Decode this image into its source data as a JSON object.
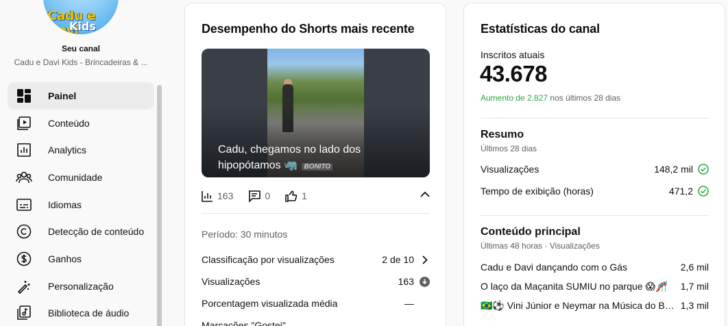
{
  "sidebar": {
    "channel_label": "Seu canal",
    "channel_name": "Cadu e Davi Kids - Brincadeiras & ...",
    "logo_text_line1": "Cadu e Davi",
    "logo_text_line2": "Kids",
    "items": [
      {
        "label": "Painel",
        "icon": "dashboard-icon",
        "active": true
      },
      {
        "label": "Conteúdo",
        "icon": "content-icon"
      },
      {
        "label": "Analytics",
        "icon": "analytics-icon"
      },
      {
        "label": "Comunidade",
        "icon": "community-icon"
      },
      {
        "label": "Idiomas",
        "icon": "subtitles-icon"
      },
      {
        "label": "Detecção de conteúdo",
        "icon": "copyright-icon"
      },
      {
        "label": "Ganhos",
        "icon": "earn-icon"
      },
      {
        "label": "Personalização",
        "icon": "customization-icon"
      },
      {
        "label": "Biblioteca de áudio",
        "icon": "audio-library-icon"
      }
    ]
  },
  "shorts_card": {
    "title": "Desempenho do Shorts mais recente",
    "thumbnail_caption": "Cadu, chegamos no lado dos hipopótamos 🦏",
    "thumbnail_tag": "BONITO",
    "metrics": {
      "views": "163",
      "comments": "0",
      "likes": "1"
    },
    "period": "Período: 30 minutos",
    "rows": [
      {
        "label": "Classificação por visualizações",
        "value": "2 de 10",
        "icon": "chevron-right-icon"
      },
      {
        "label": "Visualizações",
        "value": "163",
        "icon": "arrow-down-circle-icon"
      },
      {
        "label": "Porcentagem visualizada média",
        "value": "—"
      },
      {
        "label": "Marcações \"Gostei\"",
        "value": "—"
      }
    ]
  },
  "stats_card": {
    "title": "Estatísticas do canal",
    "subs_label": "Inscritos atuais",
    "subs_value": "43.678",
    "increase_value": "Aumento de 2.827",
    "increase_suffix": " nos últimos 28 dias",
    "summary_title": "Resumo",
    "summary_sub": "Últimos 28 dias",
    "summary_rows": [
      {
        "label": "Visualizações",
        "value": "148,2 mil"
      },
      {
        "label": "Tempo de exibição (horas)",
        "value": "471,2"
      }
    ],
    "top_title": "Conteúdo principal",
    "top_sub": "Últimas 48 horas · Visualizações",
    "top_rows": [
      {
        "label": "Cadu e Davi dançando com o Gás",
        "value": "2,6 mil"
      },
      {
        "label": "O laço da Maçanita SUMIU no parque 😱🎢",
        "value": "1,7 mil"
      },
      {
        "label": "🇧🇷⚽ Vini Júnior e Neymar na Música do Brasil",
        "value": "1,3 mil"
      }
    ]
  },
  "colors": {
    "accent_green": "#2ba640",
    "text": "#0f0f0f",
    "muted": "#606060"
  }
}
